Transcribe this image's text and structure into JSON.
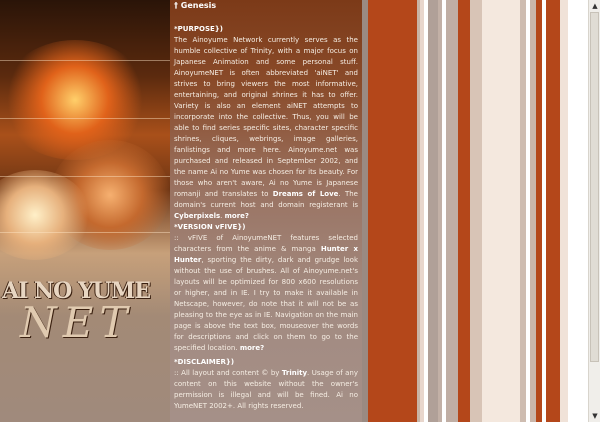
{
  "header": {
    "title": "† Genesis"
  },
  "logo": {
    "line1": "AI NO YUME",
    "line2": "NET"
  },
  "purpose": {
    "heading": "*PURPOSE})",
    "t1": "The Ainoyume Network currently serves as the humble collective of Trinity, with a major focus on Japanese Animation and some personal stuff. AinoyumeNET is often abbreviated 'aiNET' and strives to bring viewers the most informative, entertaining, and original shrines it has to offer. Variety is also an element aiNET attempts to incorporate into the collective. Thus, you will be able to find series specific sites, character specific shrines, cliques, webrings, image galleries, fanlistings and more here. Ainoyume.net was purchased and released in September 2002, and the name Ai no Yume was chosen for its beauty. For those who aren't aware, Ai no Yume is Japanese romanji and translates to",
    "bold1": "Dreams of Love",
    "t2": ". The domain's current host and domain registerant is",
    "bold2": "Cyberpixels",
    "t3": ".",
    "more": "more?"
  },
  "version": {
    "heading": "*VERSION vFIVE})",
    "t1": ":: vFIVE of AinoyumeNET features selected characters from the anime & manga",
    "bold1": "Hunter x Hunter",
    "t2": ", sporting the dirty, dark and grudge look without the use of brushes. All of Ainoyume.net's layouts will be optimized for 800 x600 resolutions or higher, and in IE. I try to make it available in Netscape, however, do note that it will not be as pleasing to the eye as in IE. Navigation on the main page is above the text box, mouseover the words for descriptions and click on them to go to the specified location.",
    "more": "more?"
  },
  "disclaimer": {
    "heading": "*DISCLAIMER})",
    "t1": ":: All layout and content © by",
    "bold1": "Trinity",
    "t2": ". Usage of any content on this website without the owner's permission is illegal and will be fined. Ai no YumeNET 2002+. All rights reserved."
  },
  "scrollbar": {
    "up": "▲",
    "down": "▼"
  }
}
